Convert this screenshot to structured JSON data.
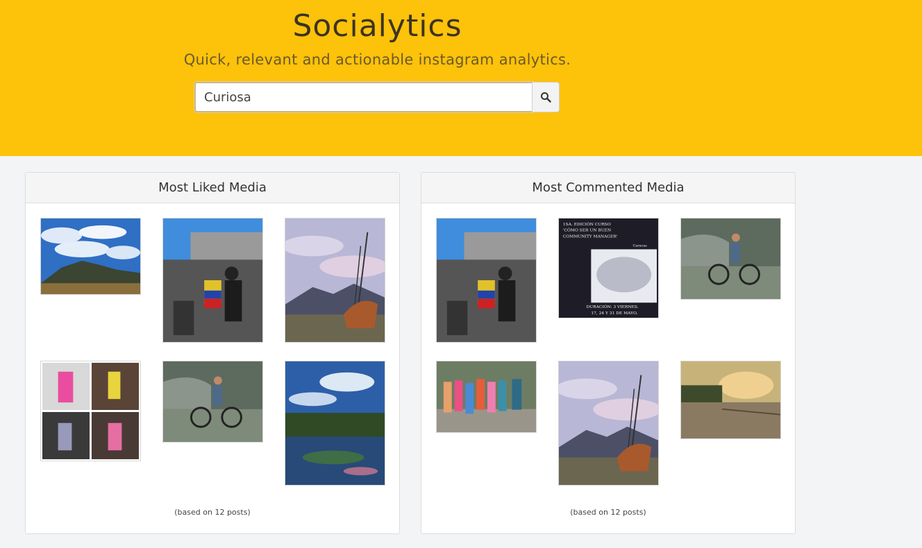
{
  "header": {
    "title": "Socialytics",
    "subtitle": "Quick, relevant and actionable instagram analytics."
  },
  "search": {
    "value": "Curiosa",
    "button_icon": "search-icon"
  },
  "colors": {
    "hero_background": "#fdc20a",
    "page_background": "#f3f4f6"
  },
  "panels": [
    {
      "title": "Most Liked Media",
      "footnote": "(based on 12 posts)",
      "media": [
        {
          "subject": "mountain-sky-photo"
        },
        {
          "subject": "flag-crowd-photo"
        },
        {
          "subject": "ship-sculpture-photo"
        },
        {
          "subject": "runner-collage-photo"
        },
        {
          "subject": "cyclist-photo"
        },
        {
          "subject": "lily-pond-photo"
        }
      ]
    },
    {
      "title": "Most Commented Media",
      "footnote": "(based on 12 posts)",
      "media": [
        {
          "subject": "flag-crowd-photo"
        },
        {
          "subject": "course-flyer-photo",
          "text": [
            "1SA. EDICIÓN CURSO",
            "'CÓMO SER UN BUEN",
            "COMMUNITY MANAGER'",
            "Caracas",
            "DURACIÓN: 3 VIERNES.",
            "17, 24 Y 31 DE MAYO."
          ]
        },
        {
          "subject": "cyclist-photo"
        },
        {
          "subject": "group-photo"
        },
        {
          "subject": "ship-sculpture-photo"
        },
        {
          "subject": "sunset-road-photo"
        }
      ]
    }
  ]
}
